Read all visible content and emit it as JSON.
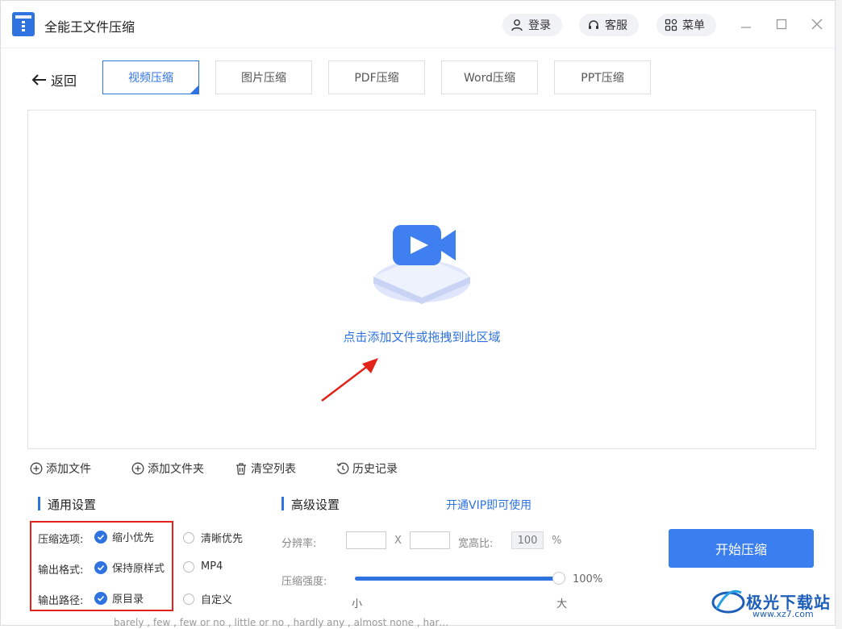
{
  "app": {
    "title": "全能王文件压缩"
  },
  "header": {
    "login": "登录",
    "service": "客服",
    "menu": "菜单"
  },
  "nav": {
    "back": "返回",
    "tabs": [
      "视频压缩",
      "图片压缩",
      "PDF压缩",
      "Word压缩",
      "PPT压缩"
    ],
    "active_tab": "视频压缩"
  },
  "dropzone": {
    "text": "点击添加文件或拖拽到此区域"
  },
  "toolbar": {
    "add_file": "添加文件",
    "add_folder": "添加文件夹",
    "clear_list": "清空列表",
    "history": "历史记录"
  },
  "general": {
    "title": "通用设置",
    "rows": [
      {
        "label": "压缩选项:",
        "checked": "缩小优先",
        "other": "清晰优先"
      },
      {
        "label": "输出格式:",
        "checked": "保持原样式",
        "other": "MP4"
      },
      {
        "label": "输出路径:",
        "checked": "原目录",
        "other": "自定义"
      }
    ]
  },
  "advanced": {
    "title": "高级设置",
    "vip_link": "开通VIP即可使用",
    "resolution_label": "分辨率:",
    "x_sep": "X",
    "aspect_label": "宽高比:",
    "aspect_value": "100",
    "percent": "%",
    "strength_label": "压缩强度:",
    "strength_value": "100%",
    "strength_level": 1.0,
    "small": "小",
    "large": "大"
  },
  "actions": {
    "start": "开始压缩"
  },
  "watermark": {
    "name": "极光下载站",
    "url": "www.xz7.com"
  },
  "bottom_strip": "barely , few , few or no , little or no , hardly any , almost none , har…",
  "colors": {
    "accent": "#2f73e0",
    "annotation": "#e2231a"
  }
}
